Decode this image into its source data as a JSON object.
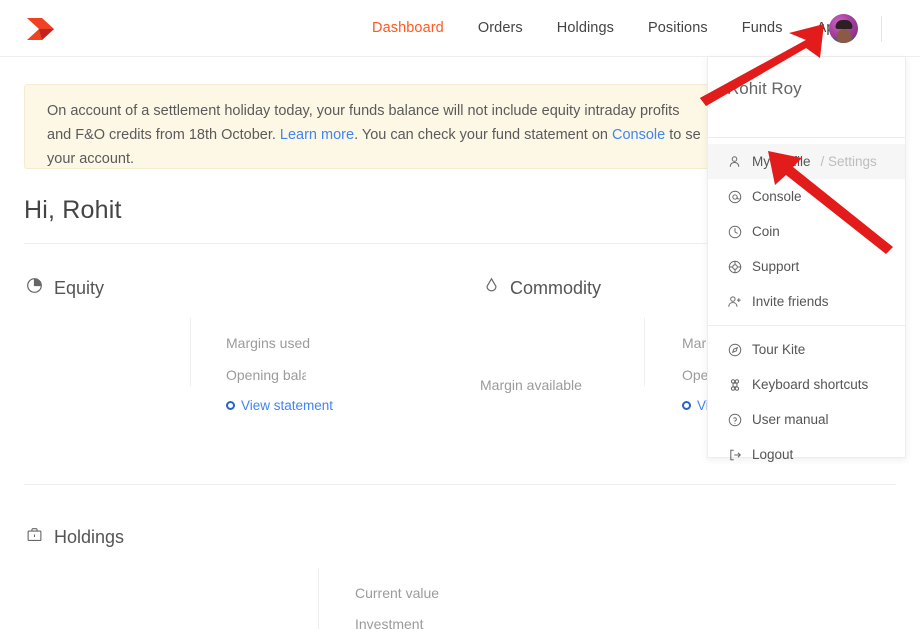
{
  "header": {
    "logo_name": "kite-logo",
    "nav_items": [
      {
        "label": "Dashboard",
        "active": true
      },
      {
        "label": "Orders",
        "active": false
      },
      {
        "label": "Holdings",
        "active": false
      },
      {
        "label": "Positions",
        "active": false
      },
      {
        "label": "Funds",
        "active": false
      },
      {
        "label": "Apps",
        "active": false
      }
    ],
    "avatar_name": "user-avatar"
  },
  "banner": {
    "text_1": "On account of a settlement holiday today, your funds balance will not include equity intraday profits ",
    "text_2": "and F&O credits from 18th October. ",
    "link_learn_more": "Learn more",
    "text_3": ". You can check your fund statement on ",
    "link_console": "Console",
    "text_4": " to se",
    "text_5": "your account."
  },
  "main": {
    "greeting": "Hi, Rohit",
    "equity": {
      "title": "Equity",
      "margins_used_label": "Margins used",
      "opening_balance_label": "Opening balance",
      "margin_available_label": "Margin available",
      "view_statement_label": "View statement"
    },
    "commodity": {
      "title": "Commodity",
      "margins_used_label": "Mar",
      "opening_balance_label": "Ope",
      "view_statement_label": "Vi"
    },
    "holdings": {
      "title": "Holdings",
      "current_value_label": "Current value",
      "investment_label": "Investment"
    }
  },
  "dropdown": {
    "user_name": "Rohit Roy",
    "items": [
      {
        "label": "My profile",
        "suffix": " / Settings",
        "icon": "person-icon",
        "highlighted": true
      },
      {
        "label": "Console",
        "suffix": "",
        "icon": "at-circle-icon",
        "highlighted": false
      },
      {
        "label": "Coin",
        "suffix": "",
        "icon": "coin-circle-icon",
        "highlighted": false
      },
      {
        "label": "Support",
        "suffix": "",
        "icon": "support-circle-icon",
        "highlighted": false
      },
      {
        "label": "Invite friends",
        "suffix": "",
        "icon": "person-add-icon",
        "highlighted": false
      },
      {
        "label": "Tour Kite",
        "suffix": "",
        "icon": "compass-icon",
        "highlighted": false
      },
      {
        "label": "Keyboard shortcuts",
        "suffix": "",
        "icon": "command-key-icon",
        "highlighted": false
      },
      {
        "label": "User manual",
        "suffix": "",
        "icon": "question-circle-icon",
        "highlighted": false
      },
      {
        "label": "Logout",
        "suffix": "",
        "icon": "logout-icon",
        "highlighted": false
      }
    ]
  },
  "annotations": {
    "arrow_color": "#e21b1b",
    "arrow_1_name": "arrow-pointing-to-avatar",
    "arrow_2_name": "arrow-pointing-to-my-profile"
  },
  "colors": {
    "accent": "#ff5722",
    "link": "#4184f3",
    "banner_bg": "#fdf8e6",
    "text": "#444444"
  }
}
